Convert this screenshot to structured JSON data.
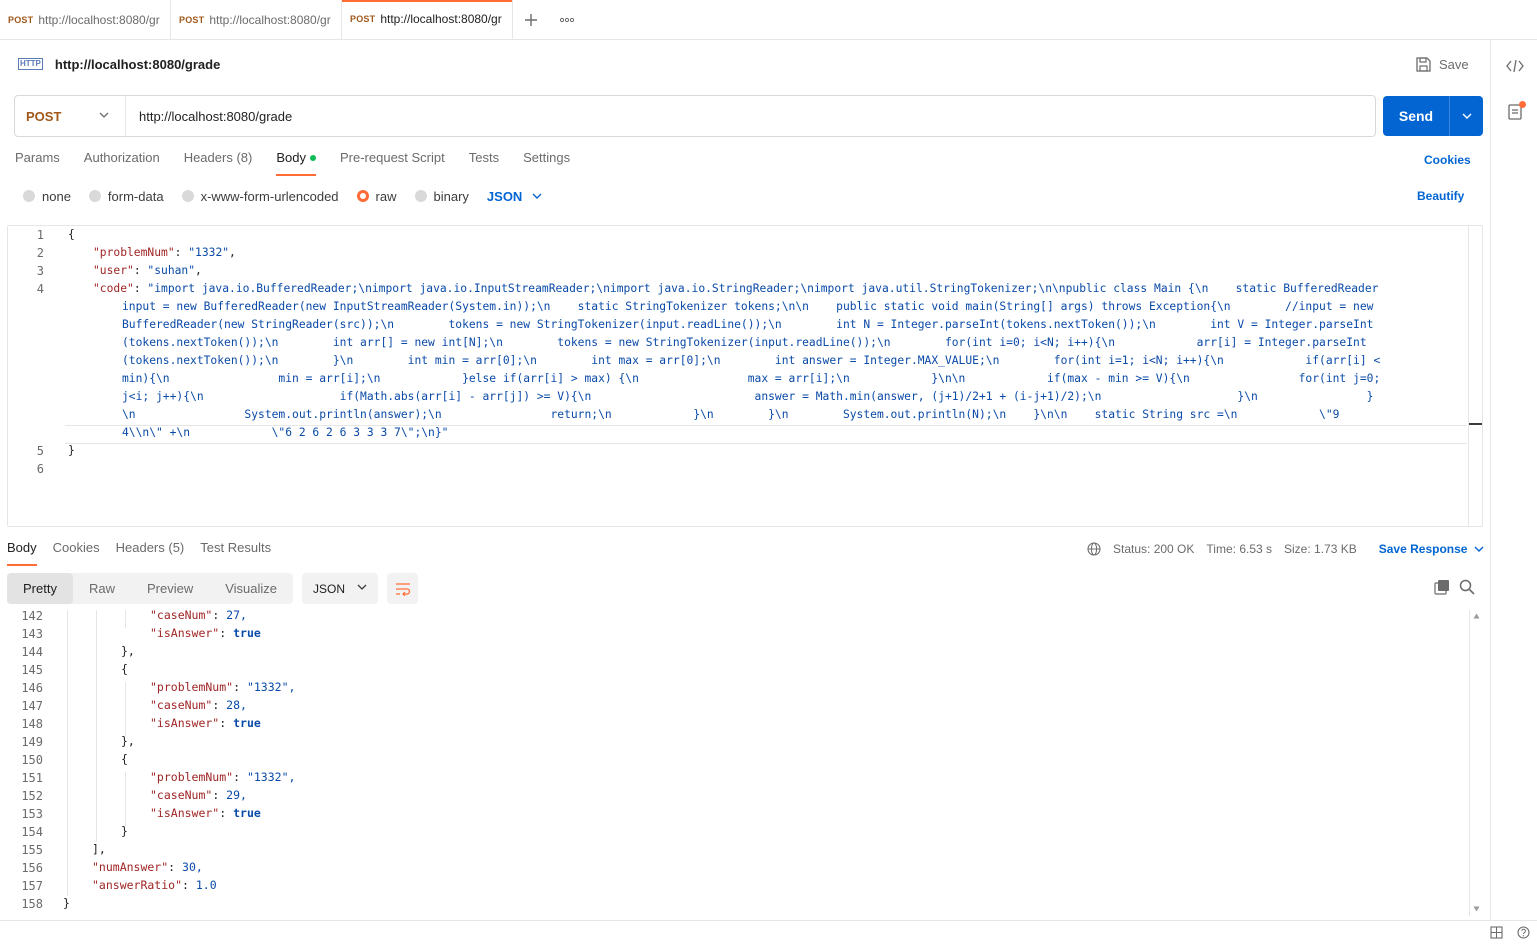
{
  "tabs": [
    {
      "method": "POST",
      "url": "http://localhost:8080/gr"
    },
    {
      "method": "POST",
      "url": "http://localhost:8080/gr"
    },
    {
      "method": "POST",
      "url": "http://localhost:8080/gr"
    }
  ],
  "request": {
    "badge": "HTTP",
    "title": "http://localhost:8080/grade",
    "save_label": "Save",
    "method": "POST",
    "url": "http://localhost:8080/grade",
    "send_label": "Send"
  },
  "req_tabs": {
    "params": "Params",
    "authorization": "Authorization",
    "headers": "Headers",
    "headers_count": "(8)",
    "body": "Body",
    "prerequest": "Pre-request Script",
    "tests": "Tests",
    "settings": "Settings",
    "cookies": "Cookies"
  },
  "body_types": {
    "none": "none",
    "form_data": "form-data",
    "urlencoded": "x-www-form-urlencoded",
    "raw": "raw",
    "binary": "binary",
    "language": "JSON",
    "beautify": "Beautify"
  },
  "editor": {
    "line_numbers": [
      "1",
      "2",
      "3",
      "4",
      "5",
      "6"
    ],
    "open_brace": "{",
    "close_brace": "}",
    "k_problem": "\"problemNum\"",
    "v_problem": "\"1332\"",
    "k_user": "\"user\"",
    "v_user": "\"suhan\"",
    "k_code": "\"code\"",
    "code_wrapped": [
      "\"import java.io.BufferedReader;\\nimport java.io.InputStreamReader;\\nimport java.io.StringReader;\\nimport java.util.StringTokenizer;\\n\\npublic class Main {\\n    static BufferedReader",
      "input = new BufferedReader(new InputStreamReader(System.in));\\n    static StringTokenizer tokens;\\n\\n    public static void main(String[] args) throws Exception{\\n        //input = new",
      "BufferedReader(new StringReader(src));\\n        tokens = new StringTokenizer(input.readLine());\\n        int N = Integer.parseInt(tokens.nextToken());\\n        int V = Integer.parseInt",
      "(tokens.nextToken());\\n        int arr[] = new int[N];\\n        tokens = new StringTokenizer(input.readLine());\\n        for(int i=0; i<N; i++){\\n            arr[i] = Integer.parseInt",
      "(tokens.nextToken());\\n        }\\n        int min = arr[0];\\n        int max = arr[0];\\n        int answer = Integer.MAX_VALUE;\\n        for(int i=1; i<N; i++){\\n            if(arr[i] <",
      "min){\\n                min = arr[i];\\n            }else if(arr[i] > max) {\\n                max = arr[i];\\n            }\\n\\n            if(max - min >= V){\\n                for(int j=0;",
      "j<i; j++){\\n                    if(Math.abs(arr[i] - arr[j]) >= V){\\n                        answer = Math.min(answer, (j+1)/2+1 + (i-j+1)/2);\\n                    }\\n                }",
      "\\n                System.out.println(answer);\\n                return;\\n            }\\n        }\\n        System.out.println(N);\\n    }\\n\\n    static String src =\\n            \\\"9",
      "4\\\\n\\\" +\\n            \\\"6 2 6 2 6 3 3 3 7\\\";\\n}\""
    ]
  },
  "response": {
    "tabs": {
      "body": "Body",
      "cookies": "Cookies",
      "headers": "Headers",
      "headers_count": "(5)",
      "tests": "Test Results"
    },
    "status_label": "Status:",
    "status": "200 OK",
    "time_label": "Time:",
    "time": "6.53 s",
    "size_label": "Size:",
    "size": "1.73 KB",
    "save_response": "Save Response",
    "views": {
      "pretty": "Pretty",
      "raw": "Raw",
      "preview": "Preview",
      "visualize": "Visualize"
    },
    "format": "JSON",
    "line_numbers": [
      "142",
      "143",
      "144",
      "145",
      "146",
      "147",
      "148",
      "149",
      "150",
      "151",
      "152",
      "153",
      "154",
      "155",
      "156",
      "157",
      "158"
    ],
    "k_caseNum": "\"caseNum\"",
    "v_27": "27,",
    "k_isAnswer": "\"isAnswer\"",
    "v_true": "true",
    "close_obj": "},",
    "close_last": "}",
    "open_obj": "{",
    "k_problemNum": "\"problemNum\"",
    "v_1332": "\"1332\",",
    "v_28": "28,",
    "v_29": "29,",
    "close_arr": "],",
    "k_numAnswer": "\"numAnswer\"",
    "v_numAnswer": "30,",
    "k_answerRatio": "\"answerRatio\"",
    "v_answerRatio": "1.0",
    "close_root": "}"
  },
  "colors": {
    "accent": "#ff6c37",
    "primary": "#0265d2",
    "method": "#a0581b"
  }
}
